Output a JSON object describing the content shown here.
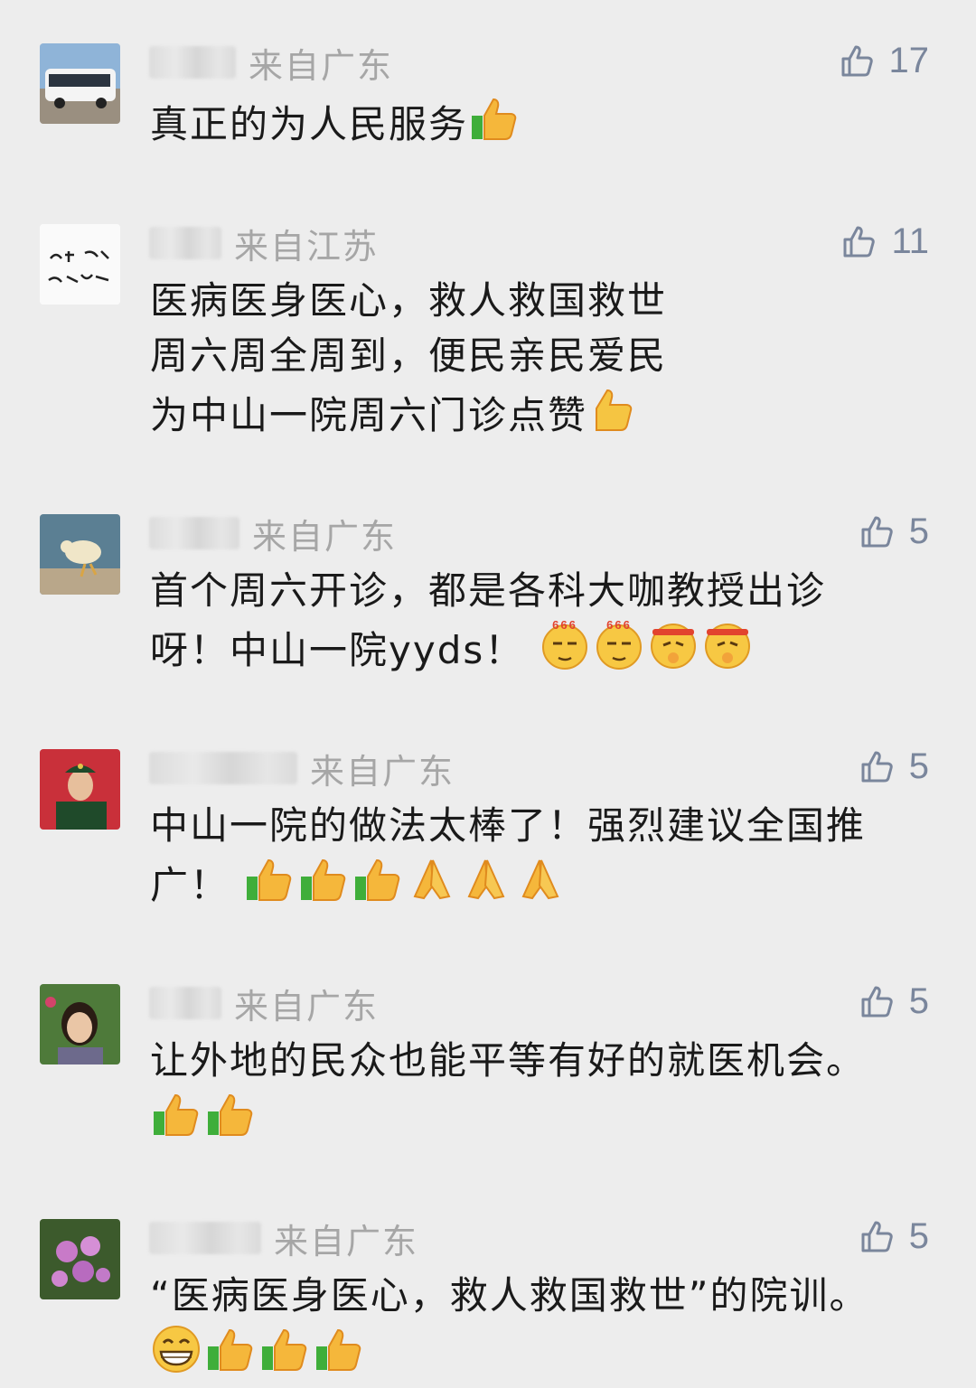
{
  "comments": [
    {
      "nick_redacted": true,
      "location": "来自广东",
      "likes": "17",
      "text": "真正的为人民服务",
      "emoji": [
        "thumbs-up"
      ]
    },
    {
      "nick_redacted": true,
      "location": "来自江苏",
      "likes": "11",
      "text": "医病医身医心，救人救国救世\n周六周全周到，便民亲民爱民\n为中山一院周六门诊点赞",
      "emoji": [
        "thumbs-up"
      ]
    },
    {
      "nick_redacted": true,
      "location": "来自广东",
      "likes": "5",
      "text": "首个周六开诊，都是各科大咖教授出诊\n呀！中山一院yyds！ ",
      "emoji": [
        "666-face",
        "666-face",
        "fighting-face",
        "fighting-face"
      ]
    },
    {
      "nick_redacted": true,
      "location": "来自广东",
      "likes": "5",
      "text": "中山一院的做法太棒了！强烈建议全国推\n广！ ",
      "emoji": [
        "thumbs-up",
        "thumbs-up",
        "thumbs-up",
        "praying-hands",
        "praying-hands",
        "praying-hands"
      ]
    },
    {
      "nick_redacted": true,
      "location": "来自广东",
      "likes": "5",
      "text": "让外地的民众也能平等有好的就医机会。\n",
      "emoji": [
        "thumbs-up",
        "thumbs-up"
      ]
    },
    {
      "nick_redacted": true,
      "location": "来自广东",
      "likes": "5",
      "text": "“医病医身医心，救人救国救世”的院训。\n",
      "emoji": [
        "grin-face",
        "thumbs-up",
        "thumbs-up",
        "thumbs-up"
      ]
    }
  ],
  "colors": {
    "background": "#ededed",
    "location": "#a6a6a6",
    "like": "#7a869c",
    "text": "#1a1a1a"
  }
}
